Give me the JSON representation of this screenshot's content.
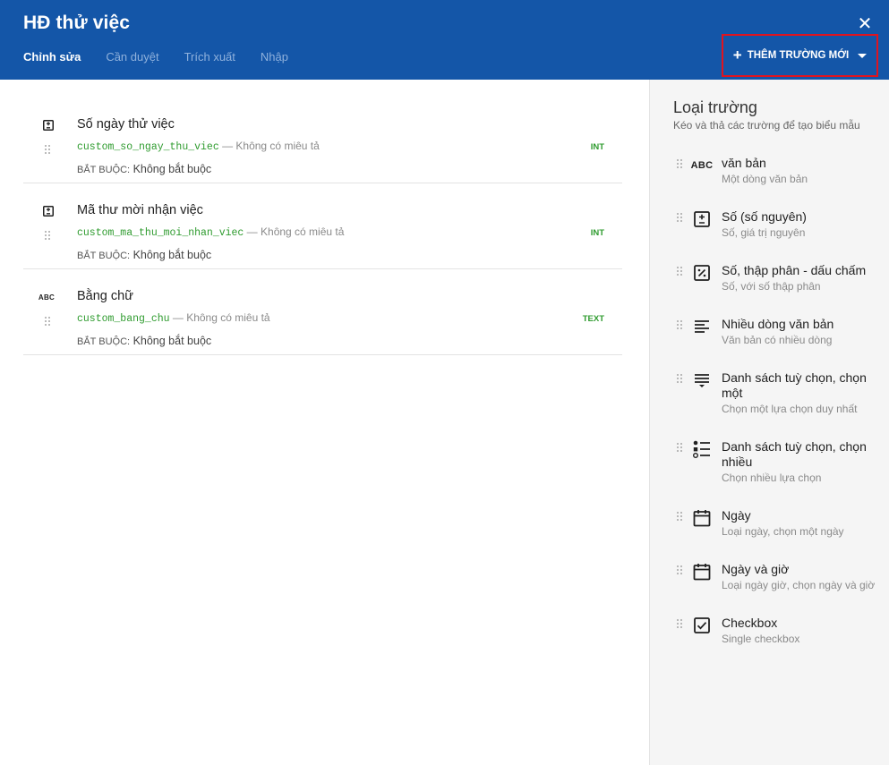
{
  "header": {
    "title": "HĐ thử việc",
    "close_icon": "✕",
    "tabs": [
      {
        "label": "Chỉnh sửa",
        "active": true
      },
      {
        "label": "Cần duyệt",
        "active": false
      },
      {
        "label": "Trích xuất",
        "active": false
      },
      {
        "label": "Nhập",
        "active": false
      }
    ],
    "add_button": {
      "label": "THÊM TRƯỜNG MỚI",
      "plus": "+"
    }
  },
  "fields": [
    {
      "icon": "number-icon",
      "name": "Số ngày thử việc",
      "code": "custom_so_ngay_thu_viec",
      "desc": " — Không có miêu tả",
      "req_label": "BẮT BUỘC:",
      "req_value": " Không bắt buộc",
      "type": "INT"
    },
    {
      "icon": "number-icon",
      "name": "Mã thư mời nhận việc",
      "code": "custom_ma_thu_moi_nhan_viec",
      "desc": " — Không có miêu tả",
      "req_label": "BẮT BUỘC:",
      "req_value": " Không bắt buộc",
      "type": "INT"
    },
    {
      "icon": "abc-icon",
      "icon_text": "ABC",
      "name": "Bằng chữ",
      "code": "custom_bang_chu",
      "desc": " — Không có miêu tả",
      "req_label": "BẮT BUỘC:",
      "req_value": " Không bắt buộc",
      "type": "TEXT"
    }
  ],
  "panel": {
    "title": "Loại trường",
    "subtitle": "Kéo và thả các trường để tạo biểu mẫu",
    "types": [
      {
        "icon": "abc-icon",
        "icon_text": "ABC",
        "name": "văn bản",
        "desc": "Một dòng văn bản"
      },
      {
        "icon": "integer-icon",
        "name": "Số (số nguyên)",
        "desc": "Số, giá trị nguyên"
      },
      {
        "icon": "decimal-icon",
        "name": "Số, thập phân - dấu chấm",
        "desc": "Số, với số thập phân"
      },
      {
        "icon": "multiline-text-icon",
        "name": "Nhiều dòng văn bản",
        "desc": "Văn bản có nhiều dòng"
      },
      {
        "icon": "single-select-icon",
        "name": "Danh sách tuỳ chọn, chọn một",
        "desc": "Chọn một lựa chọn duy nhất"
      },
      {
        "icon": "multi-select-icon",
        "name": "Danh sách tuỳ chọn, chọn nhiều",
        "desc": "Chọn nhiều lựa chọn"
      },
      {
        "icon": "calendar-icon",
        "name": "Ngày",
        "desc": "Loại ngày, chọn một ngày"
      },
      {
        "icon": "calendar-icon",
        "name": "Ngày và giờ",
        "desc": "Loại ngày giờ, chọn ngày và giờ"
      },
      {
        "icon": "checkbox-icon",
        "name": "Checkbox",
        "desc": "Single checkbox"
      }
    ]
  }
}
